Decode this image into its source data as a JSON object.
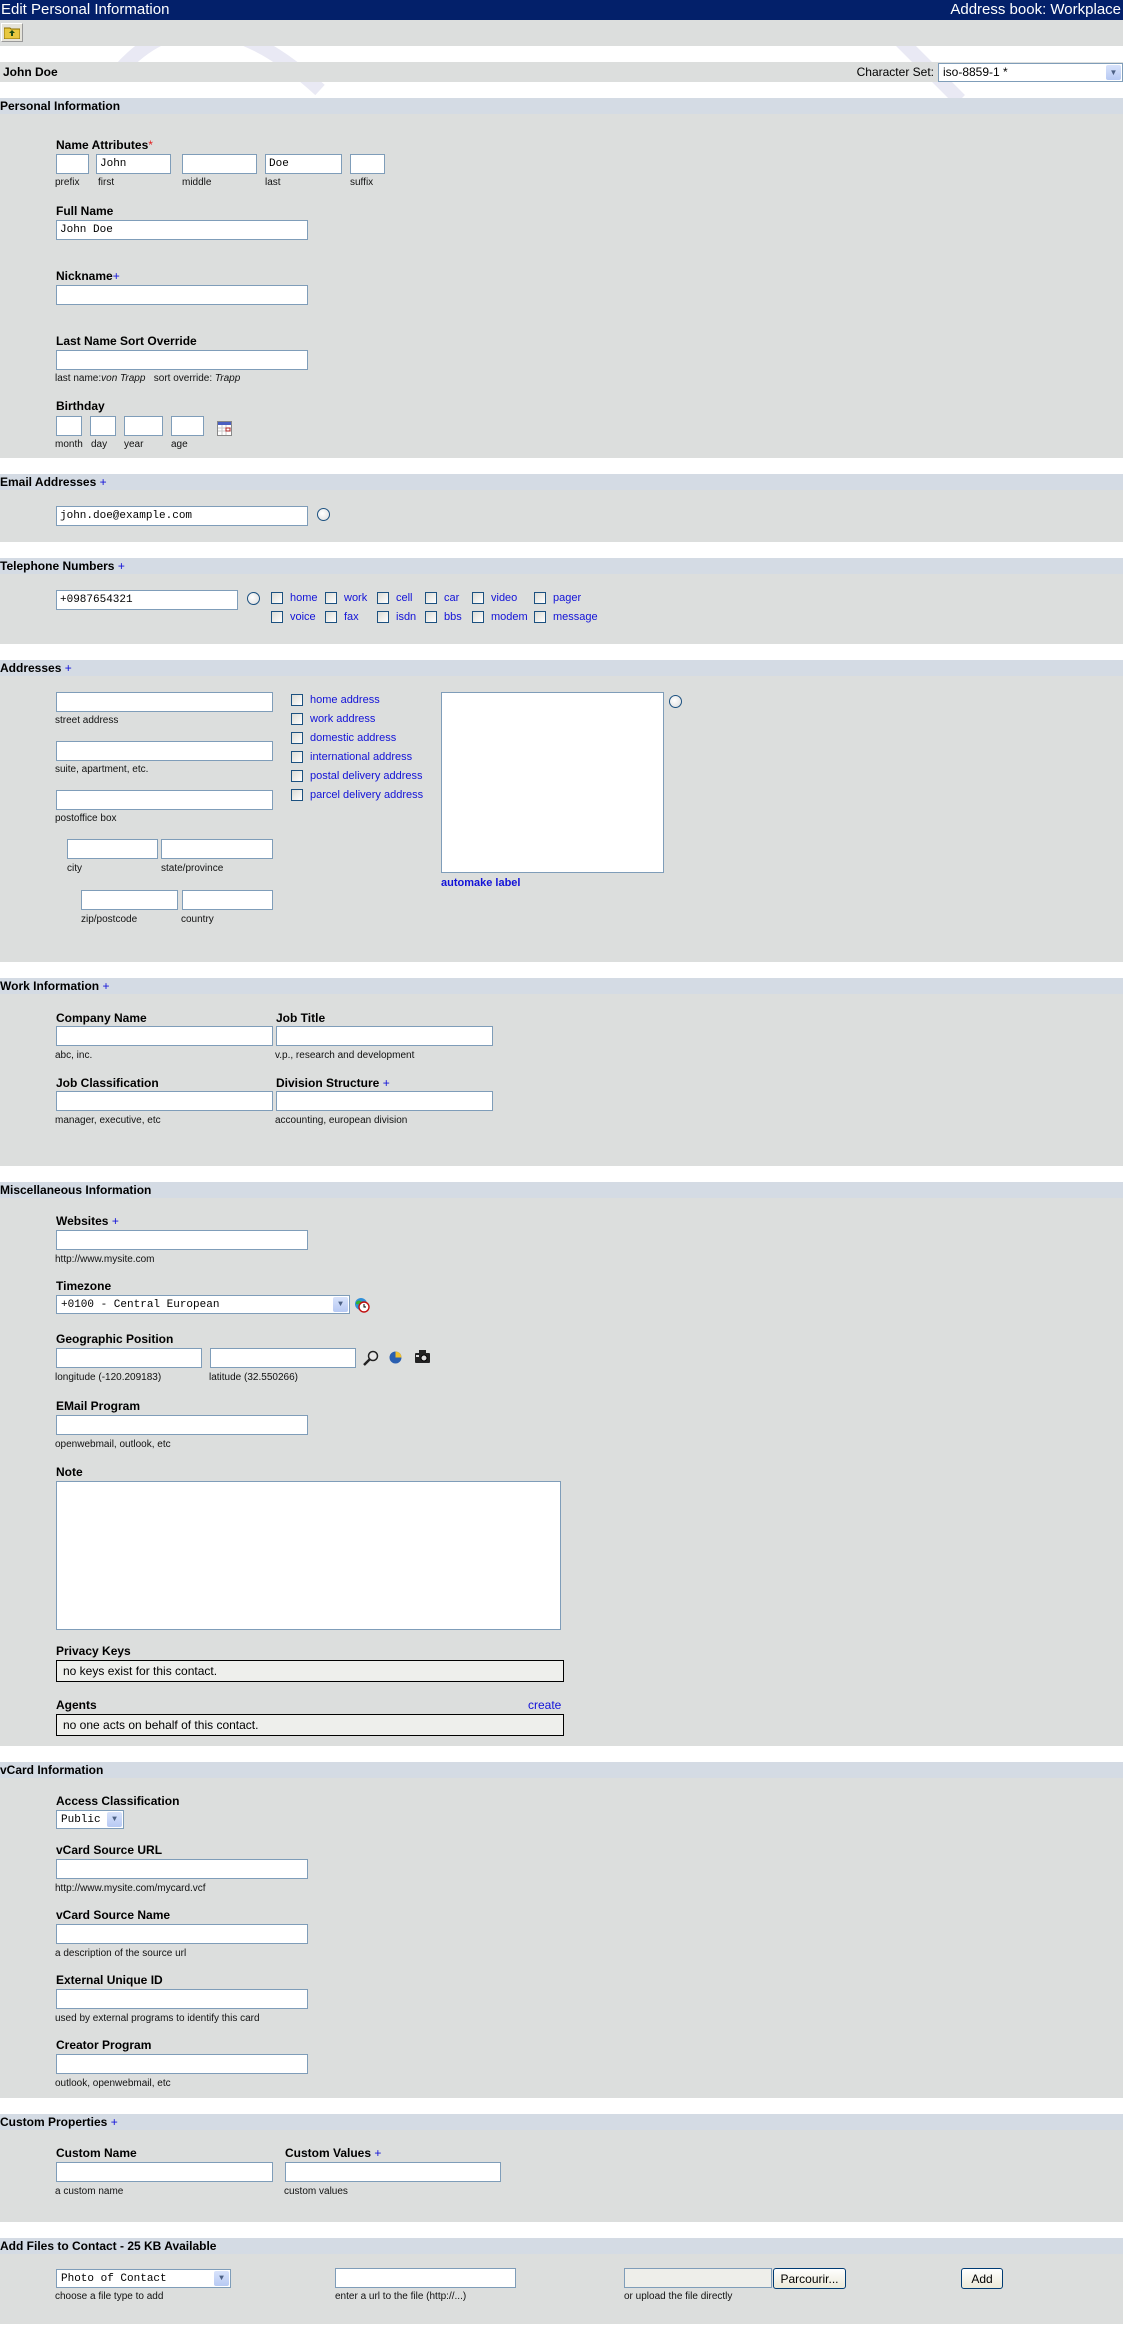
{
  "header": {
    "title": "Edit Personal Information",
    "addressbook": "Address book: Workplace"
  },
  "toolbar": {
    "back_icon": "folder-up-icon"
  },
  "contact": {
    "name": "John Doe",
    "charset_label": "Character Set:",
    "charset_value": "iso-8859-1 *"
  },
  "personal": {
    "title": "Personal Information",
    "name_attributes": {
      "label": "Name Attributes",
      "required_marker": "*",
      "fields": [
        {
          "hint": "prefix",
          "value": ""
        },
        {
          "hint": "first",
          "value": "John"
        },
        {
          "hint": "middle",
          "value": ""
        },
        {
          "hint": "last",
          "value": "Doe"
        },
        {
          "hint": "suffix",
          "value": ""
        }
      ]
    },
    "full_name": {
      "label": "Full Name",
      "value": "John Doe"
    },
    "nickname": {
      "label": "Nickname",
      "plus": "+",
      "value": ""
    },
    "sort_override": {
      "label": "Last Name Sort Override",
      "value": "",
      "hint_prefix": "last name:",
      "hint_example1": "von Trapp",
      "hint_middle": "sort override:",
      "hint_example2": "Trapp"
    },
    "birthday": {
      "label": "Birthday",
      "fields": [
        {
          "hint": "month",
          "value": ""
        },
        {
          "hint": "day",
          "value": ""
        },
        {
          "hint": "year",
          "value": ""
        },
        {
          "hint": "age",
          "value": ""
        }
      ],
      "calendar_icon": "calendar-icon"
    }
  },
  "email": {
    "title": "Email Addresses",
    "plus": "+",
    "value": "john.doe@example.com"
  },
  "phone": {
    "title": "Telephone Numbers",
    "plus": "+",
    "value": "+0987654321",
    "types_row1": [
      "home",
      "work",
      "cell",
      "car",
      "video",
      "pager"
    ],
    "types_row2": [
      "voice",
      "fax",
      "isdn",
      "bbs",
      "modem",
      "message"
    ]
  },
  "addresses": {
    "title": "Addresses",
    "plus": "+",
    "street_hint": "street address",
    "suite_hint": "suite, apartment, etc.",
    "pobox_hint": "postoffice box",
    "city_hint": "city",
    "state_hint": "state/province",
    "zip_hint": "zip/postcode",
    "country_hint": "country",
    "types": [
      "home address",
      "work address",
      "domestic address",
      "international address",
      "postal delivery address",
      "parcel delivery address"
    ],
    "automake_label": "automake label"
  },
  "work": {
    "title": "Work Information",
    "plus": "+",
    "company_label": "Company Name",
    "company_hint": "abc, inc.",
    "jobtitle_label": "Job Title",
    "jobtitle_hint": "v.p., research and development",
    "jobclass_label": "Job Classification",
    "jobclass_hint": "manager, executive, etc",
    "division_label": "Division Structure",
    "division_plus": "+",
    "division_hint": "accounting, european division"
  },
  "misc": {
    "title": "Miscellaneous Information",
    "websites_label": "Websites",
    "websites_plus": "+",
    "websites_hint": "http://www.mysite.com",
    "timezone_label": "Timezone",
    "timezone_value": "+0100 - Central European",
    "geo_label": "Geographic Position",
    "longitude_hint": "longitude  (-120.209183)",
    "latitude_hint": "latitude  (32.550266)",
    "emailprog_label": "EMail Program",
    "emailprog_hint": "openwebmail, outlook, etc",
    "note_label": "Note",
    "note_value": "",
    "privacy_label": "Privacy Keys",
    "privacy_value": "no keys exist for this contact.",
    "agents_label": "Agents",
    "agents_create": "create",
    "agents_value": "no one acts on behalf of this contact."
  },
  "vcard": {
    "title": "vCard Information",
    "access_label": "Access Classification",
    "access_value": "Public",
    "source_url_label": "vCard Source URL",
    "source_url_hint": "http://www.mysite.com/mycard.vcf",
    "source_name_label": "vCard Source Name",
    "source_name_hint": "a description of the source url",
    "uid_label": "External Unique ID",
    "uid_hint": "used by external programs to identify this card",
    "creator_label": "Creator Program",
    "creator_hint": "outlook, openwebmail, etc"
  },
  "custom": {
    "title": "Custom Properties",
    "plus": "+",
    "name_label": "Custom Name",
    "name_hint": "a custom name",
    "values_label": "Custom Values",
    "values_plus": "+",
    "values_hint": "custom values"
  },
  "files": {
    "title": "Add Files to Contact - 25 KB Available",
    "type_value": "Photo of Contact",
    "type_hint": "choose a file type to add",
    "url_hint": "enter a url to the file (http://...)",
    "upload_hint": "or upload the file directly",
    "browse_label": "Parcourir...",
    "add_label": "Add"
  }
}
